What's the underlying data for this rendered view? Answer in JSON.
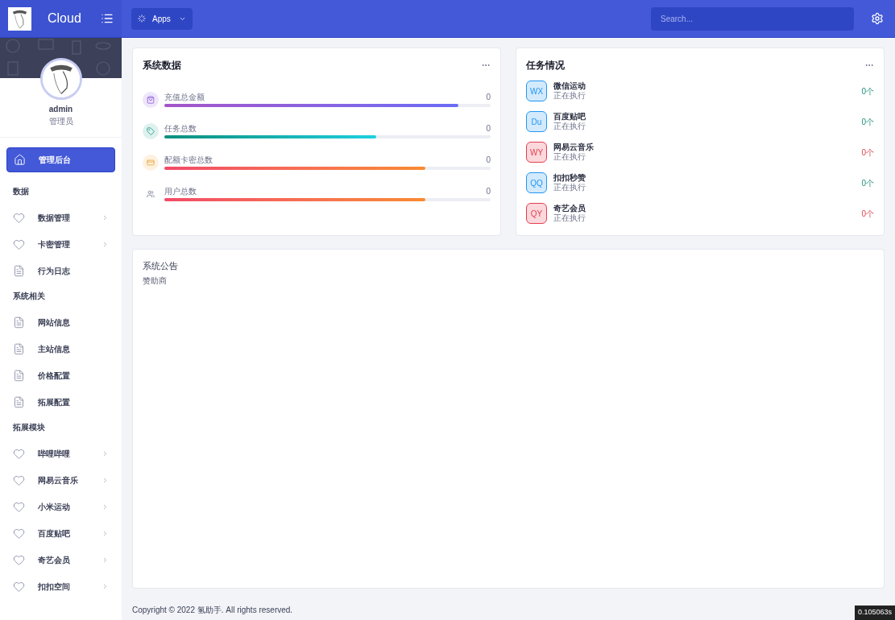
{
  "brand": {
    "name": "Cloud"
  },
  "topbar": {
    "apps_label": "Apps",
    "search": {
      "placeholder": "Search..."
    }
  },
  "profile": {
    "name": "admin",
    "role": "管理员"
  },
  "sidebar": {
    "items": [
      {
        "kind": "home",
        "label": "管理后台",
        "selected": true,
        "has_submenu": false
      },
      {
        "kind": "section",
        "label": "数据"
      },
      {
        "kind": "heart",
        "label": "数据管理",
        "selected": false,
        "has_submenu": true
      },
      {
        "kind": "heart",
        "label": "卡密管理",
        "selected": false,
        "has_submenu": true
      },
      {
        "kind": "doc",
        "label": "行为日志",
        "selected": false,
        "has_submenu": false
      },
      {
        "kind": "section",
        "label": "系统相关"
      },
      {
        "kind": "doc",
        "label": "网站信息",
        "selected": false,
        "has_submenu": false
      },
      {
        "kind": "doc",
        "label": "主站信息",
        "selected": false,
        "has_submenu": false
      },
      {
        "kind": "doc",
        "label": "价格配置",
        "selected": false,
        "has_submenu": false
      },
      {
        "kind": "doc",
        "label": "拓展配置",
        "selected": false,
        "has_submenu": false
      },
      {
        "kind": "section",
        "label": "拓展模块"
      },
      {
        "kind": "heart",
        "label": "哔哩哔哩",
        "selected": false,
        "has_submenu": true
      },
      {
        "kind": "heart",
        "label": "网易云音乐",
        "selected": false,
        "has_submenu": true
      },
      {
        "kind": "heart",
        "label": "小米运动",
        "selected": false,
        "has_submenu": true
      },
      {
        "kind": "heart",
        "label": "百度贴吧",
        "selected": false,
        "has_submenu": true
      },
      {
        "kind": "heart",
        "label": "奇艺会员",
        "selected": false,
        "has_submenu": true
      },
      {
        "kind": "heart",
        "label": "扣扣空间",
        "selected": false,
        "has_submenu": true
      }
    ]
  },
  "stats_card": {
    "title": "系统数据",
    "metrics": [
      {
        "kind": "bag",
        "label": "充值总金额",
        "value": "0",
        "level": 0.9
      },
      {
        "kind": "tag",
        "label": "任务总数",
        "value": "0",
        "level": 0.65
      },
      {
        "kind": "card",
        "label": "配额卡密总数",
        "value": "0",
        "level": 0.8
      },
      {
        "kind": "users",
        "label": "用户总数",
        "value": "0",
        "level": 0.8
      }
    ]
  },
  "tasks_card": {
    "title": "任务情况",
    "tasks": [
      {
        "badge": "WX",
        "name": "微信运动",
        "status": "正在执行",
        "count": "0个",
        "color": "#2196f3"
      },
      {
        "badge": "Du",
        "name": "百度贴吧",
        "status": "正在执行",
        "count": "0个",
        "color": "#2196f3"
      },
      {
        "badge": "WY",
        "name": "网易云音乐",
        "status": "正在执行",
        "count": "0个",
        "color": "#e53e4f"
      },
      {
        "badge": "QQ",
        "name": "扣扣秒赞",
        "status": "正在执行",
        "count": "0个",
        "color": "#2196f3"
      },
      {
        "badge": "QY",
        "name": "奇艺会员",
        "status": "正在执行",
        "count": "0个",
        "color": "#e53e4f"
      }
    ]
  },
  "notice_card": {
    "title": "系统公告",
    "text": "赞助商"
  },
  "footer": {
    "copyright": "Copyright © 2022 氢助手. All rights reserved.",
    "timing": "0.105063s"
  }
}
